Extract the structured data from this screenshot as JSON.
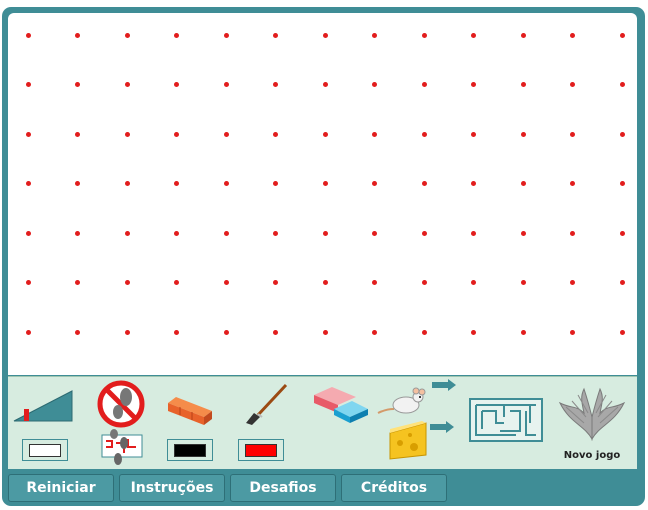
{
  "board": {
    "rows": 7,
    "cols": 13,
    "dot_color": "#e21d1d",
    "background": "#ffffff"
  },
  "toolbar": {
    "tools": [
      {
        "name": "slope-tool",
        "icon": "ramp-icon"
      },
      {
        "name": "no-walk-tool",
        "icon": "prohibited-footprints-icon"
      },
      {
        "name": "brick-tool",
        "icon": "brick-wall-icon"
      },
      {
        "name": "paintbrush-tool",
        "icon": "paintbrush-icon"
      },
      {
        "name": "eraser-tool",
        "icon": "eraser-icon"
      },
      {
        "name": "mouse-tool",
        "icon": "mouse-icon"
      },
      {
        "name": "cheese-tool",
        "icon": "cheese-icon"
      },
      {
        "name": "maze-tool",
        "icon": "maze-icon"
      }
    ],
    "swatches": [
      {
        "name": "white-swatch",
        "color": "#ffffff"
      },
      {
        "name": "black-swatch",
        "color": "#000000"
      },
      {
        "name": "red-swatch",
        "color": "#ff0000"
      }
    ],
    "new_game_label": "Novo jogo"
  },
  "nav": {
    "buttons": [
      "Reiniciar",
      "Instruções",
      "Desafios",
      "Créditos"
    ]
  },
  "colors": {
    "frame": "#3f8d96",
    "toolbar": "#d7ece0",
    "button": "#4c9aa3"
  }
}
